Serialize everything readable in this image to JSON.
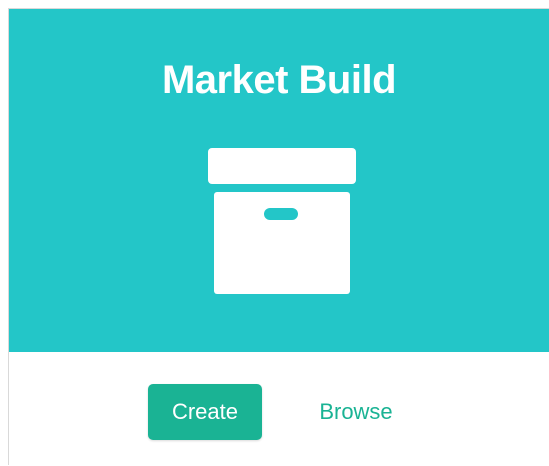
{
  "card": {
    "title": "Market Build",
    "icon": "archive-box-icon",
    "actions": {
      "create_label": "Create",
      "browse_label": "Browse"
    }
  },
  "colors": {
    "header_background": "#23c6c8",
    "primary": "#1ab394",
    "icon_fill": "#ffffff"
  }
}
